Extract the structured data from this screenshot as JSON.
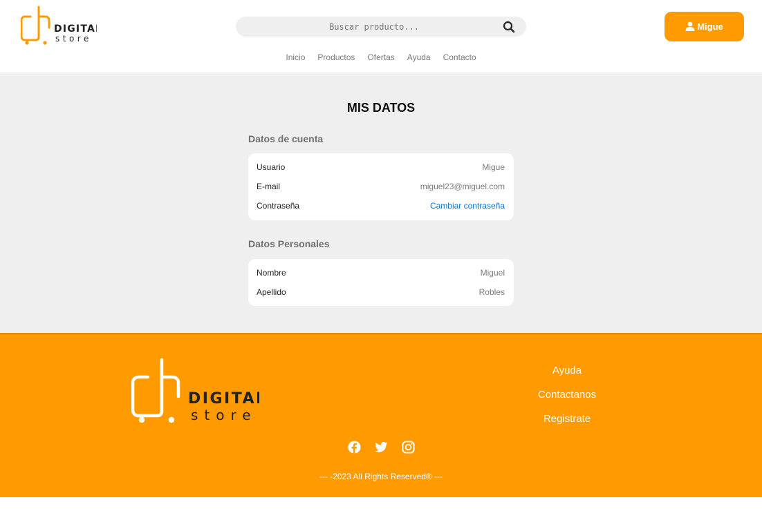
{
  "brand": {
    "logo_word_top": "DIGITAL",
    "logo_word_bottom": "store",
    "accent": "#ff9a00"
  },
  "header": {
    "search_placeholder": "Buscar producto...",
    "user_label": "Migue",
    "nav": [
      "Inicio",
      "Productos",
      "Ofertas",
      "Ayuda",
      "Contacto"
    ]
  },
  "main": {
    "title": "MIS DATOS",
    "account": {
      "heading": "Datos de cuenta",
      "user_label": "Usuario",
      "user_value": "Migue",
      "email_label": "E-mail",
      "email_value": "miguel23@miguel.com",
      "password_label": "Contraseña",
      "password_link": "Cambiar contraseña"
    },
    "personal": {
      "heading": "Datos Personales",
      "name_label": "Nombre",
      "name_value": "Miguel",
      "lastname_label": "Apellido",
      "lastname_value": "Robles"
    }
  },
  "footer": {
    "links": [
      "Ayuda",
      "Contactanos",
      "Registrate"
    ],
    "social_icons": [
      "facebook-icon",
      "twitter-icon",
      "instagram-icon"
    ],
    "copyright": "--- -2023 All Rights Reserved® ---"
  }
}
